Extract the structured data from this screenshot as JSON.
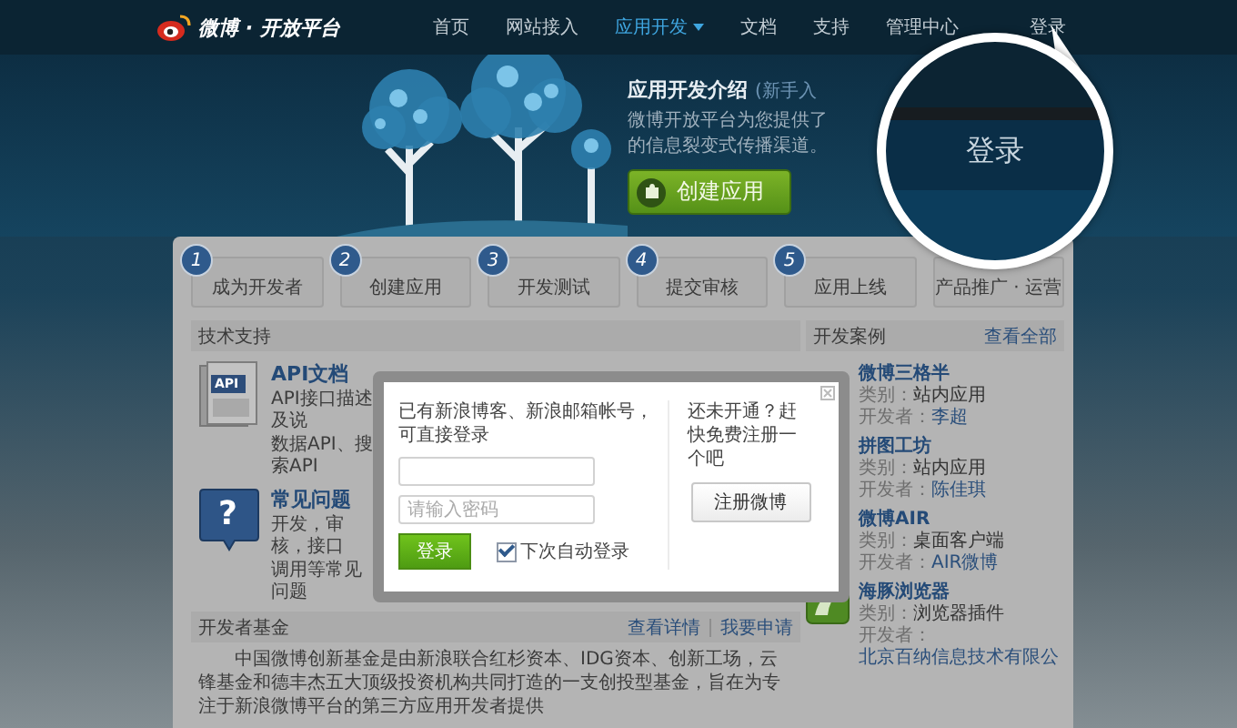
{
  "nav": {
    "logo": "微博 · 开放平台",
    "items": [
      {
        "label": "首页",
        "selected": false,
        "dropdown": false
      },
      {
        "label": "网站接入",
        "selected": false,
        "dropdown": false
      },
      {
        "label": "应用开发",
        "selected": true,
        "dropdown": true
      },
      {
        "label": "文档",
        "selected": false,
        "dropdown": false
      },
      {
        "label": "支持",
        "selected": false,
        "dropdown": false
      },
      {
        "label": "管理中心",
        "selected": false,
        "dropdown": false
      }
    ],
    "login": "登录"
  },
  "hero": {
    "title": "应用开发介绍",
    "beginner_link": "(新手入",
    "description": [
      "微博开放平台为您提供了",
      "的信息裂变式传播渠道。"
    ],
    "create_button": "创建应用"
  },
  "magnifier": {
    "label": "登录"
  },
  "steps": [
    {
      "number": "1",
      "label": "成为开发者"
    },
    {
      "number": "2",
      "label": "创建应用"
    },
    {
      "number": "3",
      "label": "开发测试"
    },
    {
      "number": "4",
      "label": "提交审核"
    },
    {
      "number": "5",
      "label": "应用上线"
    },
    {
      "label": "产品推广 · 运营"
    }
  ],
  "tech_support": {
    "title": "技术支持",
    "items": [
      {
        "kind": "api",
        "icon_label": "API",
        "title": "API文档",
        "lines": [
          "API接口描述及说",
          "数据API、搜索API"
        ]
      },
      {
        "kind": "faq",
        "icon_label": "?",
        "title": "常见问题",
        "lines": [
          "开发，审核，接口",
          "调用等常见问题"
        ]
      }
    ]
  },
  "fund": {
    "title": "开发者基金",
    "links": [
      "查看详情",
      "我要申请"
    ],
    "text": "中国微博创新基金是由新浪联合红杉资本、IDG资本、创新工场，云锋基金和德丰杰五大顶级投资机构共同打造的一支创投型基金，旨在为专注于新浪微博平台的第三方应用开发者提供"
  },
  "cases": {
    "title": "开发案例",
    "view_all": "查看全部",
    "items": [
      {
        "kind": "plain",
        "name": "微博三格半",
        "category_label": "类别：",
        "category": "站内应用",
        "developer_label": "开发者：",
        "developer": "李超"
      },
      {
        "kind": "plain",
        "name": "拼图工坊",
        "category_label": "类别：",
        "category": "站内应用",
        "developer_label": "开发者：",
        "developer": "陈佳琪"
      },
      {
        "kind": "client",
        "name": "微博AIR",
        "category_label": "类别：",
        "category": "桌面客户端",
        "developer_label": "开发者：",
        "developer": "AIR微博"
      },
      {
        "kind": "browser",
        "name": "海豚浏览器",
        "category_label": "类别：",
        "category": "浏览器插件",
        "developer_label": "开发者：",
        "developer": "北京百纳信息技术有限公"
      }
    ]
  },
  "login_dialog": {
    "prompt": "已有新浪博客、新浪邮箱帐号，可直接登录",
    "password": {
      "placeholder": "请输入密码"
    },
    "login_button": "登录",
    "remember": {
      "label": "下次自动登录",
      "checked": true
    },
    "register_prompt": "还未开通？赶快免费注册一个吧",
    "register_button": "注册微博"
  }
}
